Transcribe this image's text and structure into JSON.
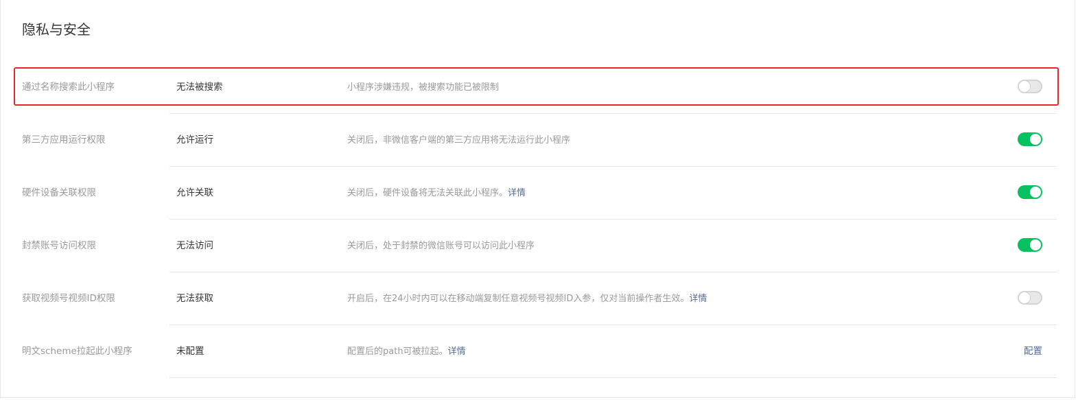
{
  "page": {
    "title": "隐私与安全"
  },
  "rows": [
    {
      "label": "通过名称搜索此小程序",
      "status": "无法被搜索",
      "desc": "小程序涉嫌违规，被搜索功能已被限制",
      "link": "",
      "toggle": false
    },
    {
      "label": "第三方应用运行权限",
      "status": "允许运行",
      "desc": "关闭后，非微信客户端的第三方应用将无法运行此小程序",
      "link": "",
      "toggle": true
    },
    {
      "label": "硬件设备关联权限",
      "status": "允许关联",
      "desc": "关闭后，硬件设备将无法关联此小程序。",
      "link": "详情",
      "toggle": true
    },
    {
      "label": "封禁账号访问权限",
      "status": "无法访问",
      "desc": "关闭后，处于封禁的微信账号可以访问此小程序",
      "link": "",
      "toggle": true
    },
    {
      "label": "获取视频号视频ID权限",
      "status": "无法获取",
      "desc": "开启后，在24小时内可以在移动端复制任意视频号视频ID入参，仅对当前操作者生效。",
      "link": "详情",
      "toggle": false
    },
    {
      "label": "明文scheme拉起此小程序",
      "status": "未配置",
      "desc": "配置后的path可被拉起。",
      "link": "详情",
      "action": "配置"
    }
  ],
  "colors": {
    "accent_green": "#07c160",
    "link_blue": "#576b95",
    "highlight_red": "#e8262a"
  }
}
